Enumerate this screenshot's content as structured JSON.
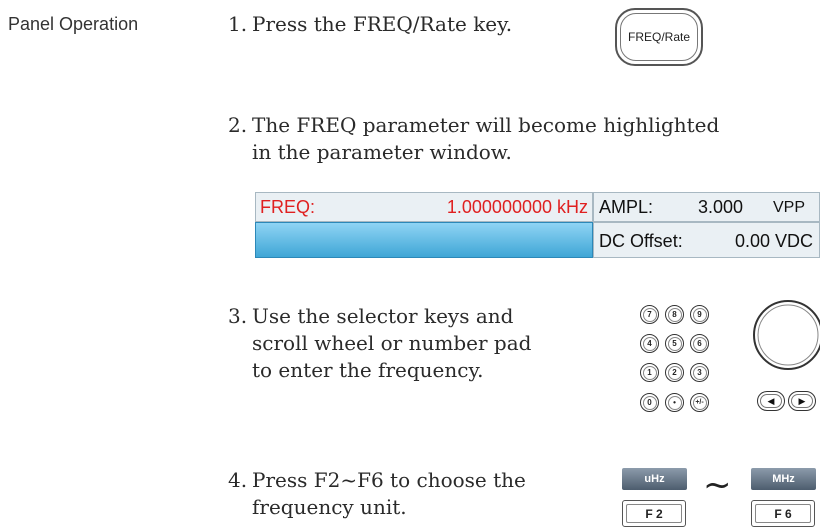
{
  "section_label": "Panel Operation",
  "steps": [
    {
      "num": "1.",
      "text": "Press the FREQ/Rate key."
    },
    {
      "num": "2.",
      "line1": "The FREQ parameter will become highlighted",
      "line2": "in the parameter window."
    },
    {
      "num": "3.",
      "line1": "Use the selector keys and",
      "line2": "scroll wheel or number pad",
      "line3": "to enter the frequency."
    },
    {
      "num": "4.",
      "line1": "Press F2~F6 to choose the",
      "line2": "frequency unit."
    }
  ],
  "freq_key": {
    "label": "FREQ/Rate"
  },
  "param_window": {
    "freq_label": "FREQ:",
    "freq_value": "1.000000000 kHz",
    "ampl_label": "AMPL:",
    "ampl_value": "3.000",
    "ampl_unit": "VPP",
    "dc_label": "DC Offset:",
    "dc_value": "0.00 VDC",
    "colors": {
      "highlight_text": "#e02020",
      "selected_bar": "#3fa6d6"
    }
  },
  "numpad": {
    "keys": [
      "7",
      "8",
      "9",
      "4",
      "5",
      "6",
      "1",
      "2",
      "3",
      "0",
      "•",
      "+/-"
    ]
  },
  "arrow_keys": {
    "left_icon": "left-arrow-icon",
    "right_icon": "right-arrow-icon",
    "left": "◀",
    "right": "▶"
  },
  "unit_keys": {
    "left_unit": "uHz",
    "right_unit": "MHz",
    "left_fkey": "F 2",
    "right_fkey": "F 6",
    "range_symbol": "~"
  }
}
